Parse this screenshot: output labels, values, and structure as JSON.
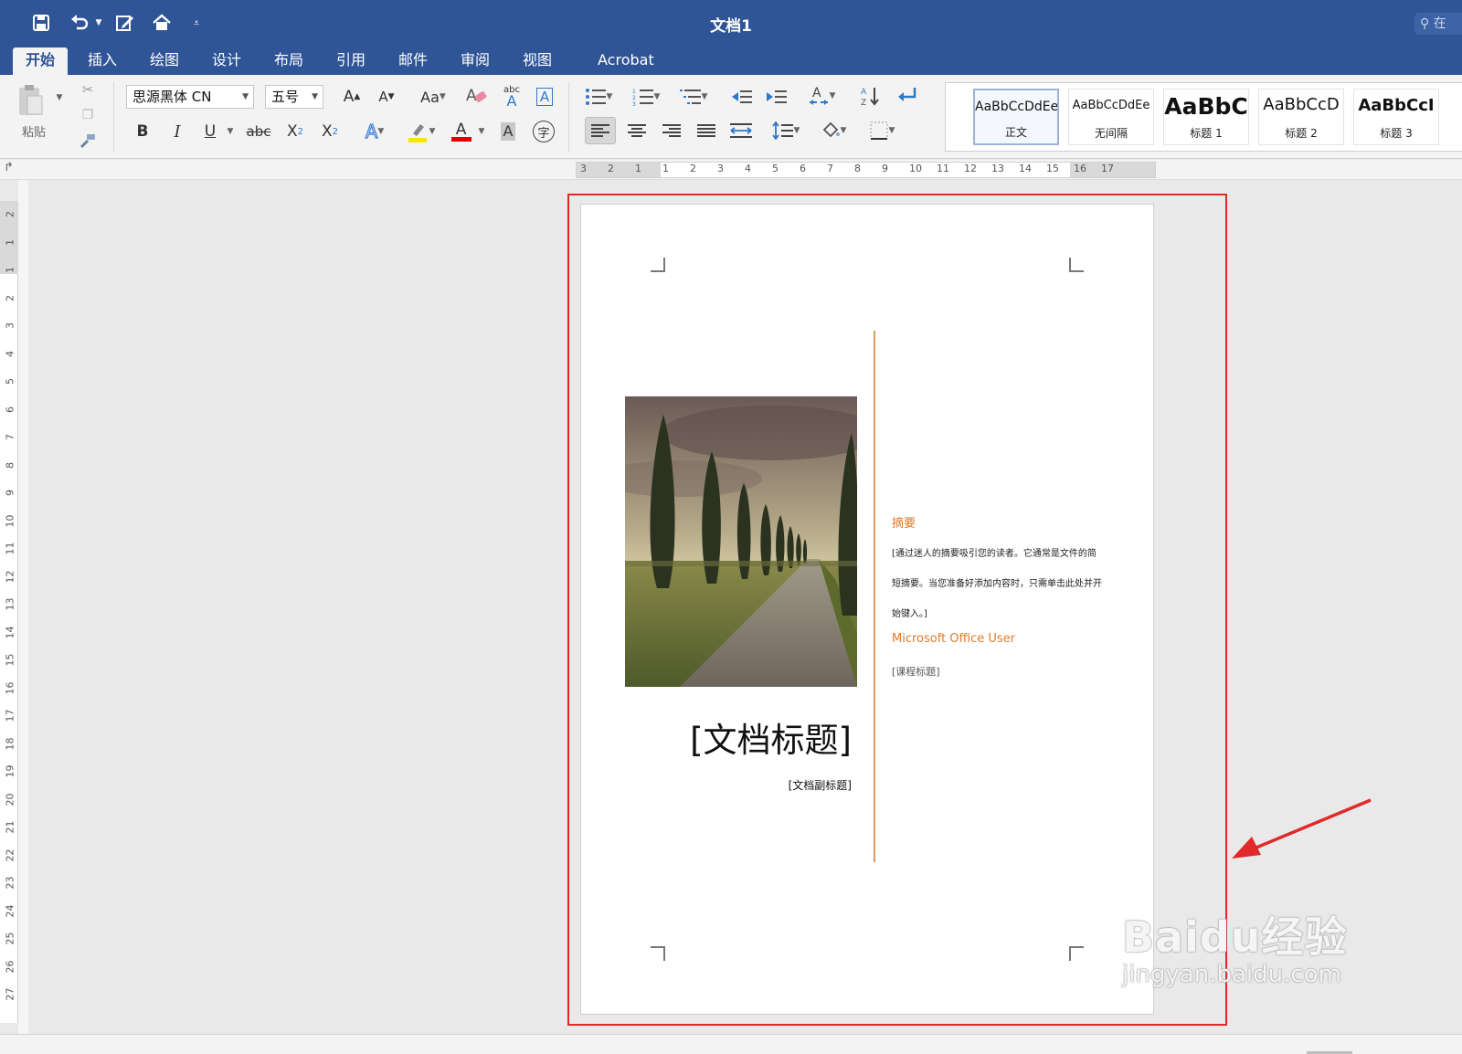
{
  "window": {
    "title": "文档1",
    "search_fragment": "在"
  },
  "tabs": [
    {
      "label": "开始",
      "active": true
    },
    {
      "label": "插入"
    },
    {
      "label": "绘图"
    },
    {
      "label": "设计"
    },
    {
      "label": "布局"
    },
    {
      "label": "引用"
    },
    {
      "label": "邮件"
    },
    {
      "label": "审阅"
    },
    {
      "label": "视图"
    },
    {
      "label": "Acrobat"
    }
  ],
  "quick_access": [
    "save-icon",
    "undo-icon",
    "edit-doc-icon",
    "home-icon",
    "customize-icon"
  ],
  "ribbon": {
    "paste_label": "粘贴",
    "font_name": "思源黑体 CN",
    "font_size": "五号",
    "grow_font": "A",
    "shrink_font": "A",
    "change_case": "Aa",
    "spell_abc": "abc",
    "text_box_a": "A",
    "bold": "B",
    "italic": "I",
    "underline": "U",
    "strike": "abc",
    "subscript": "X",
    "subscript_sub": "2",
    "superscript": "X",
    "superscript_sup": "2",
    "text_effect": "A",
    "font_color": "A",
    "char_shading": "A",
    "enclose_char": "字",
    "styles": [
      {
        "sample": "AaBbCcDdEe",
        "name": "正文",
        "selected": true
      },
      {
        "sample": "AaBbCcDdEe",
        "name": "无间隔"
      },
      {
        "sample": "AaBbC",
        "name": "标题 1"
      },
      {
        "sample": "AaBbCcD",
        "name": "标题 2"
      },
      {
        "sample": "AaBbCcI",
        "name": "标题 3"
      }
    ]
  },
  "ruler": {
    "h_numbers": [
      "3",
      "2",
      "1",
      "1",
      "2",
      "3",
      "4",
      "5",
      "6",
      "7",
      "8",
      "9",
      "10",
      "11",
      "12",
      "13",
      "14",
      "15",
      "16",
      "17"
    ],
    "v_numbers": [
      "2",
      "1",
      "1",
      "2",
      "3",
      "4",
      "5",
      "6",
      "7",
      "8",
      "9",
      "10",
      "11",
      "12",
      "13",
      "14",
      "15",
      "16",
      "17",
      "18",
      "19",
      "20",
      "21",
      "22",
      "23",
      "24",
      "25",
      "26",
      "27"
    ]
  },
  "document": {
    "title": "[文档标题]",
    "subtitle": "[文档副标题]",
    "abstract_heading": "摘要",
    "abstract_lines": [
      "[通过迷人的摘要吸引您的读者。它通常是文件的简",
      "短摘要。当您准备好添加内容时，只需单击此处并开",
      "始键入。]"
    ],
    "author": "Microsoft Office User",
    "course_title": "[课程标题]"
  },
  "watermark": {
    "main": "Baidu经验",
    "url": "jingyan.baidu.com"
  },
  "colors": {
    "titlebar": "#2f5597",
    "accent_orange": "#e07a2c",
    "highlight_box": "#e02a2a",
    "arrow": "#e02a2a"
  }
}
